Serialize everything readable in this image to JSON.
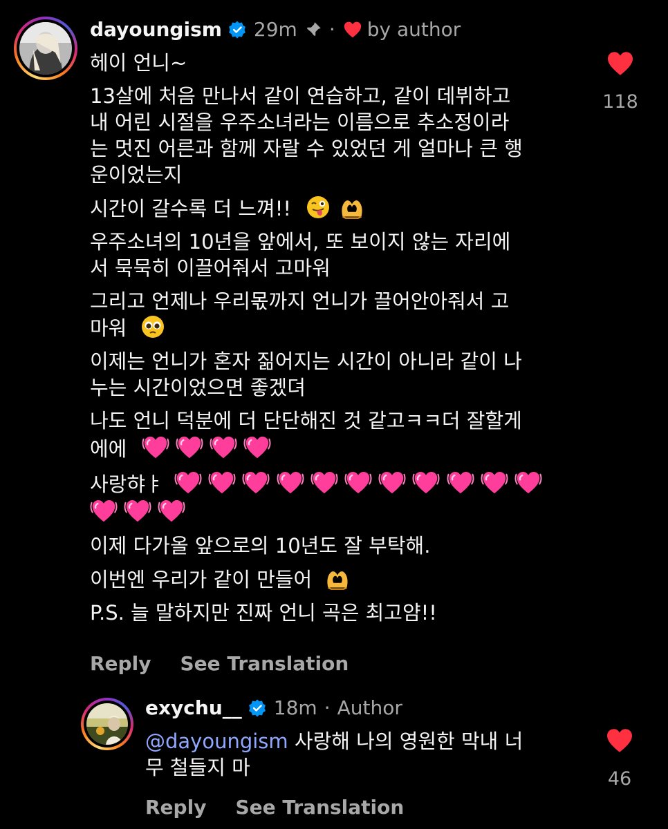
{
  "comment": {
    "username": "dayoungism",
    "time": "29m",
    "separator": "·",
    "by_author": "by author",
    "lines": [
      "헤이 언니~",
      "13살에 처음 만나서 같이 연습하고, 같이 데뷔하고",
      "내 어린 시절을 우주소녀라는 이름으로 추소정이라",
      "는 멋진 어른과 함께 자랄 수 있었던 게 얼마나 큰 행",
      "운이었는지",
      "시간이 갈수록 더 느껴!!",
      "우주소녀의 10년을 앞에서, 또 보이지 않는 자리에",
      "서 묵묵히 이끌어줘서 고마워",
      "그리고 언제나 우리몫까지 언니가 끌어안아줘서 고",
      "마워",
      "이제는 언니가 혼자 짊어지는 시간이 아니라 같이 나",
      "누는 시간이었으면 좋겠뎌",
      "나도 언니 덕분에 더 단단해진 것 같고ㅋㅋ더 잘할게",
      "에에",
      "사랑햐ㅑ",
      "이제 다가올 앞으로의 10년도 잘 부탁해.",
      "이번엔 우리가 같이 만들어",
      "P.S. 늘 말하지만 진짜 언니 곡은 최고얌!!"
    ],
    "like_count": "118",
    "reply_label": "Reply",
    "translate_label": "See Translation"
  },
  "reply": {
    "username": "exychu__",
    "time": "18m",
    "separator": "·",
    "author_label": "Author",
    "mention": "@dayoungism",
    "text_line1": " 사랑해 나의 영원한 막내 너",
    "text_line2": "무 철들지 마",
    "like_count": "46",
    "reply_label": "Reply",
    "translate_label": "See Translation"
  },
  "colors": {
    "background": "#000000",
    "text": "#f5f5f5",
    "muted": "#a8a8a8",
    "heart": "#ff3040",
    "verified": "#0095f6",
    "mention": "#8fa8ff"
  },
  "icons": [
    "verified-icon",
    "pin-icon",
    "heart-icon",
    "winking-tongue-emoji",
    "heart-hands-emoji",
    "pleading-face-emoji",
    "two-hearts-emoji"
  ]
}
